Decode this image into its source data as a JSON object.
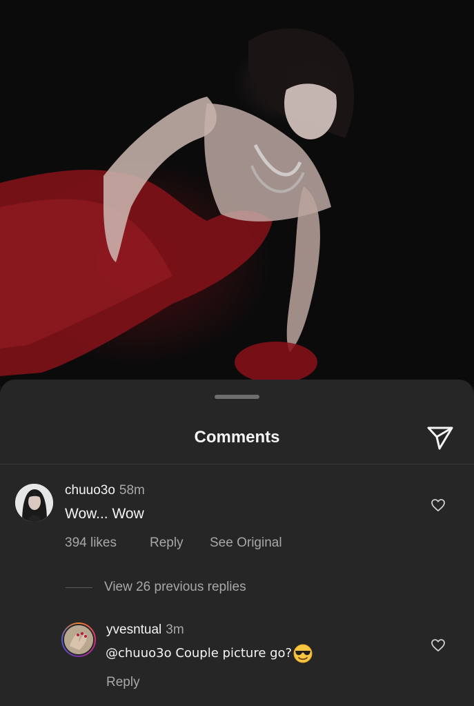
{
  "sheet": {
    "title": "Comments"
  },
  "comments": [
    {
      "username": "chuuo3o",
      "time": "58m",
      "text": "Wow... Wow",
      "likes": "394 likes",
      "reply_label": "Reply",
      "see_original_label": "See Original"
    }
  ],
  "view_replies": "View 26 previous replies",
  "reply": {
    "username": "yvesntual",
    "time": "3m",
    "text": "@chuuo3o Couple picture go?",
    "emoji": "😎",
    "reply_label": "Reply"
  },
  "icons": {
    "share": "send-icon",
    "like": "heart-outline-icon"
  }
}
